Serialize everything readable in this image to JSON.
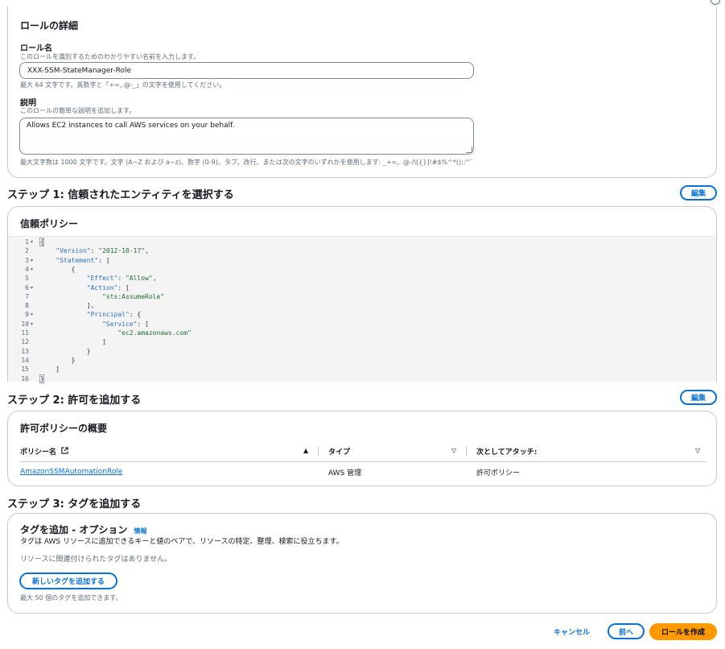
{
  "role_details": {
    "title": "ロールの詳細",
    "name_label": "ロール名",
    "name_hint": "このロールを識別するためのわかりやすい名前を入力します。",
    "name_value": "XXX-SSM-StateManager-Role",
    "name_constraint": "最大 64 文字です。英数字と「+=,.@-_」の文字を使用してください。",
    "description_label": "説明",
    "description_hint": "このロールの簡単な説明を追加します。",
    "description_value": "Allows EC2 instances to call AWS services on your behalf.",
    "description_constraint": "最大文字数は 1000 文字です。文字 (A~Z および a~z)、数字 (0-9)、タブ、改行、または次の文字のいずれかを使用します: _+=,. @-/\\[{}]!#$%^*();:\"'`"
  },
  "step1": {
    "title": "ステップ 1: 信頼されたエンティティを選択する",
    "edit_label": "編集",
    "policy_title": "信頼ポリシー",
    "code_lines": [
      {
        "n": "1",
        "fold": true,
        "text": "{"
      },
      {
        "n": "2",
        "fold": false,
        "text": "    \"Version\": \"2012-10-17\","
      },
      {
        "n": "3",
        "fold": true,
        "text": "    \"Statement\": ["
      },
      {
        "n": "4",
        "fold": true,
        "text": "        {"
      },
      {
        "n": "5",
        "fold": false,
        "text": "            \"Effect\": \"Allow\","
      },
      {
        "n": "6",
        "fold": true,
        "text": "            \"Action\": ["
      },
      {
        "n": "7",
        "fold": false,
        "text": "                \"sts:AssumeRole\""
      },
      {
        "n": "8",
        "fold": false,
        "text": "            ],"
      },
      {
        "n": "9",
        "fold": true,
        "text": "            \"Principal\": {"
      },
      {
        "n": "10",
        "fold": true,
        "text": "                \"Service\": ["
      },
      {
        "n": "11",
        "fold": false,
        "text": "                    \"ec2.amazonaws.com\""
      },
      {
        "n": "12",
        "fold": false,
        "text": "                ]"
      },
      {
        "n": "13",
        "fold": false,
        "text": "            }"
      },
      {
        "n": "14",
        "fold": false,
        "text": "        }"
      },
      {
        "n": "15",
        "fold": false,
        "text": "    ]"
      },
      {
        "n": "16",
        "fold": false,
        "text": "}"
      }
    ]
  },
  "step2": {
    "title": "ステップ 2: 許可を追加する",
    "edit_label": "編集",
    "summary_title": "許可ポリシーの概要",
    "columns": [
      "ポリシー名",
      "タイプ",
      "次としてアタッチ:"
    ],
    "rows": [
      {
        "policy": "AmazonSSMAutomationRole",
        "type": "AWS 管理",
        "attached_as": "許可ポリシー"
      }
    ]
  },
  "step3": {
    "title": "ステップ 3: タグを追加する",
    "tags_title": "タグを追加 - オプション",
    "info_label": "情報",
    "tags_desc": "タグは AWS リソースに追加できるキーと値のペアで、リソースの特定、整理、検索に役立ちます。",
    "no_tags": "リソースに関連付けられたタグはありません。",
    "add_tag_label": "新しいタグを追加する",
    "tag_limit": "最大 50 個のタグを追加できます。"
  },
  "footer": {
    "cancel_label": "キャンセル",
    "prev_label": "前へ",
    "create_label": "ロールを作成"
  },
  "colors": {
    "primary": "#ff9900",
    "link": "#0972d3"
  }
}
